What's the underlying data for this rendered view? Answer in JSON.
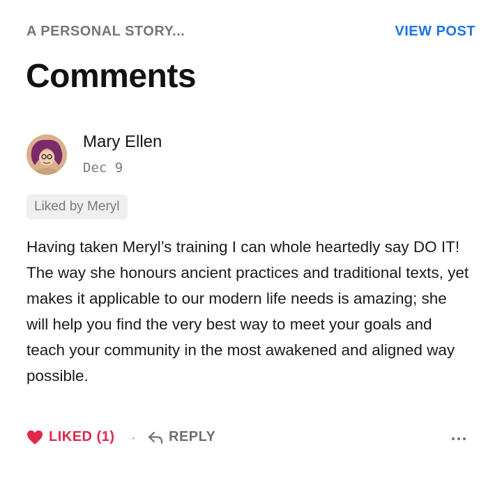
{
  "header": {
    "post_title": "A PERSONAL STORY...",
    "view_post_label": "VIEW POST",
    "page_title": "Comments"
  },
  "comment": {
    "author": "Mary Ellen",
    "date": "Dec 9",
    "liked_by": "Liked by Meryl",
    "body": "Having taken Meryl’s training I can whole heartedly say DO IT!  The way she honours ancient practices and traditional texts, yet makes it applicable to our modern life needs is amazing; she will help you find the very best way to meet your goals and teach your community in the most awakened and aligned way possible.",
    "actions": {
      "liked_label": "LIKED (1)",
      "separator": "·",
      "reply_label": "REPLY"
    }
  },
  "colors": {
    "accent_blue": "#1a73e8",
    "liked_red": "#e0284b",
    "muted_gray": "#757575"
  },
  "icons": [
    "heart-icon",
    "reply-arrow-icon",
    "more-options-icon",
    "avatar-image"
  ]
}
